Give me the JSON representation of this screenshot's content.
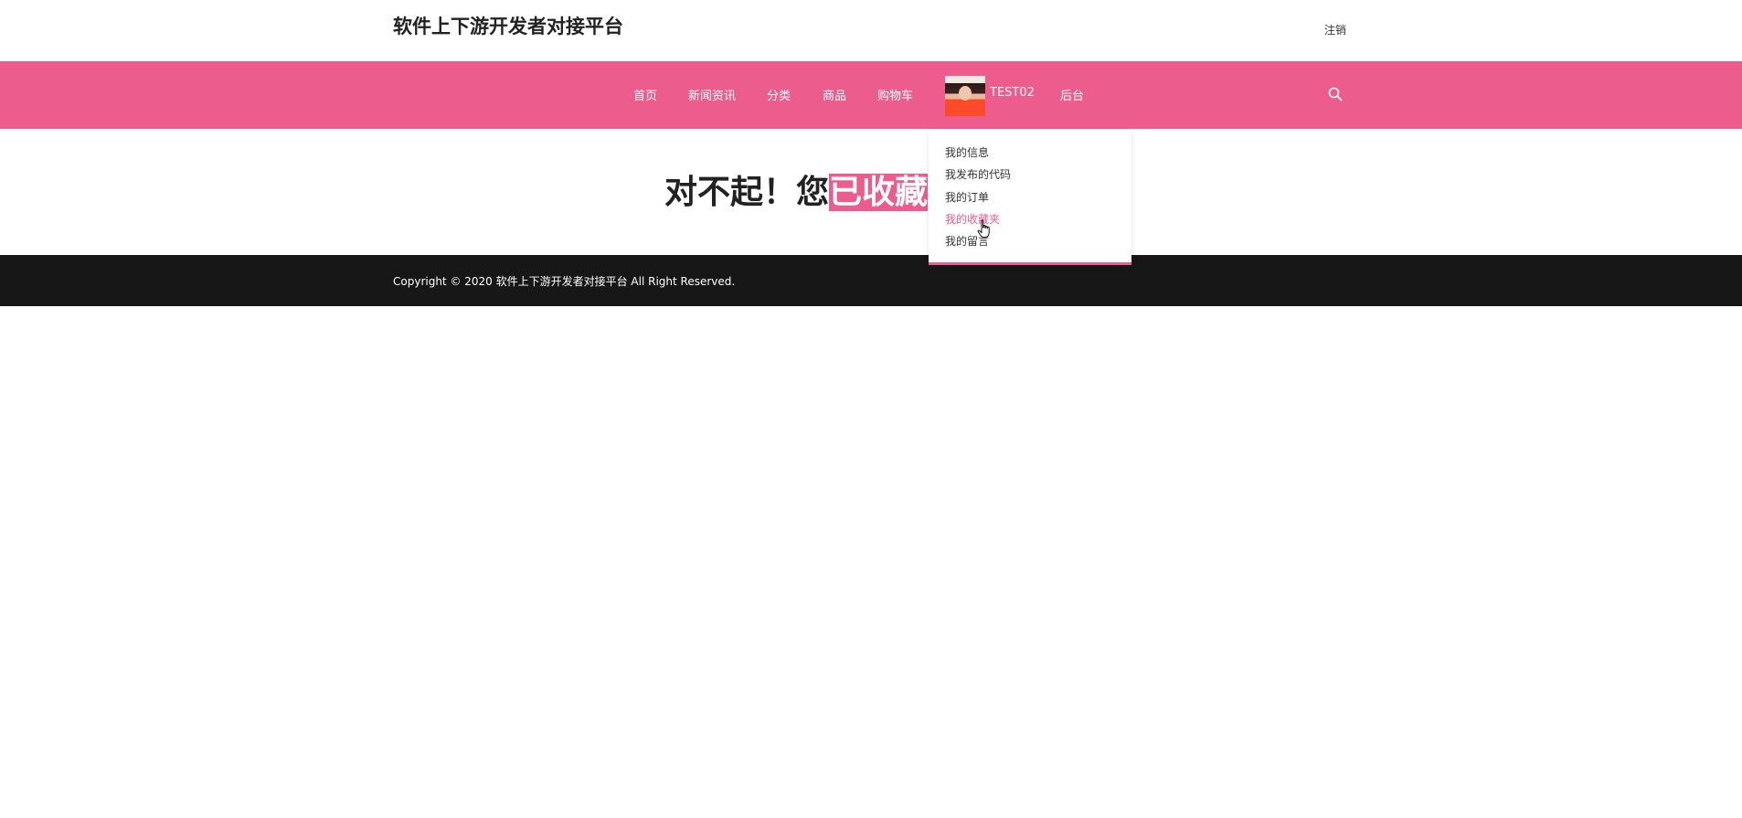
{
  "header": {
    "site_title": "软件上下游开发者对接平台",
    "logout_label": "注销"
  },
  "nav": {
    "items": [
      {
        "label": "首页"
      },
      {
        "label": "新闻资讯"
      },
      {
        "label": "分类"
      },
      {
        "label": "商品"
      },
      {
        "label": "购物车"
      }
    ],
    "username": "TEST02",
    "admin_label": "后台",
    "search_icon": "search-icon",
    "avatar_icon": "user-avatar"
  },
  "dropdown": {
    "items": [
      {
        "label": "我的信息"
      },
      {
        "label": "我发布的代码"
      },
      {
        "label": "我的订单"
      },
      {
        "label": "我的收藏夹",
        "active": true
      },
      {
        "label": "我的留言"
      }
    ]
  },
  "main": {
    "headline_prefix": "对不起！您",
    "headline_highlight": "已收藏"
  },
  "footer": {
    "copyright": "Copyright © 2020 软件上下游开发者对接平台 All Right Reserved."
  },
  "colors": {
    "brand_pink": "#ec5c8d",
    "footer_bg": "#171717",
    "text_dark": "#222222"
  }
}
